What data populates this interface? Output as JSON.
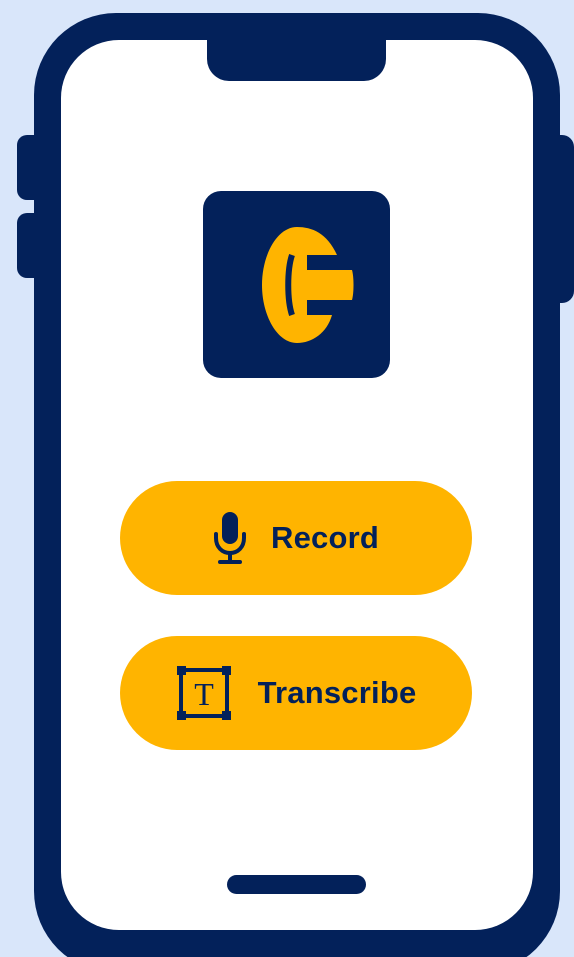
{
  "buttons": {
    "record_label": "Record",
    "transcribe_label": "Transcribe",
    "transcribe_icon_letter": "T"
  },
  "colors": {
    "background": "#d9e6fa",
    "phone_frame": "#03215a",
    "accent": "#ffb400",
    "screen": "#ffffff"
  },
  "icons": {
    "logo": "g-logo-icon",
    "record": "microphone-icon",
    "transcribe": "text-box-icon"
  }
}
